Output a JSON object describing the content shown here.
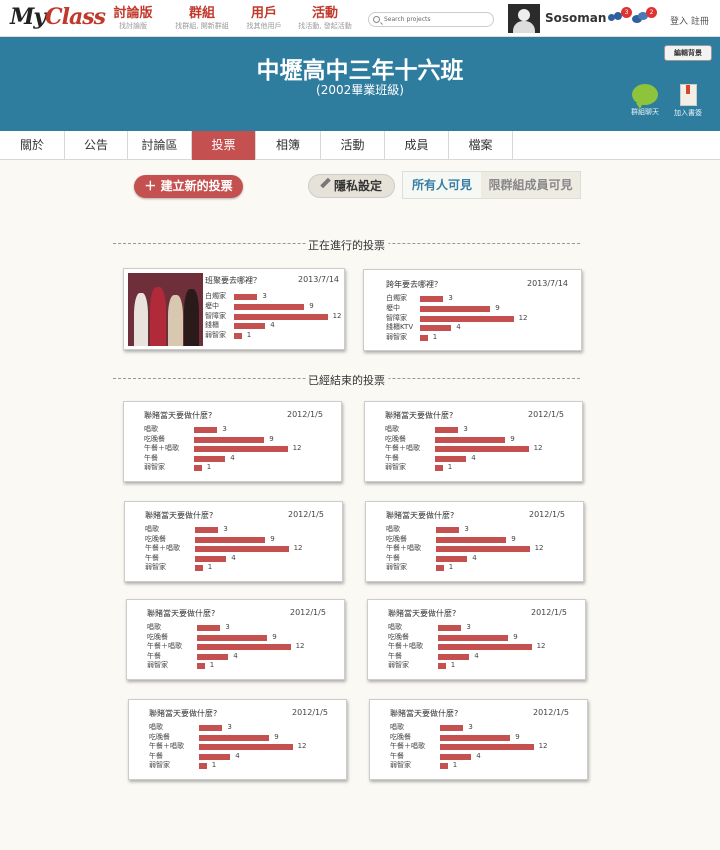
{
  "nav": {
    "logo_main": "My",
    "logo_accent": "Class",
    "items": [
      {
        "label": "討論版",
        "sub": "找討論版"
      },
      {
        "label": "群組",
        "sub": "找群組, 開新群組"
      },
      {
        "label": "用戶",
        "sub": "找其他用戶"
      },
      {
        "label": "活動",
        "sub": "找活動, 發起活動"
      }
    ],
    "search_placeholder": "Search projects",
    "username": "Sosoman",
    "badge_friends": "3",
    "badge_messages": "2",
    "login_label": "登入 註冊"
  },
  "banner": {
    "title": "中壢高中三年十六班",
    "subtitle": "(2002畢業班級)",
    "edit_bg_label": "編輯背景",
    "chat_label": "群組聊天",
    "bookmark_label": "加入書簽",
    "bg_color": "#2e7c9e"
  },
  "tabs": [
    "關於",
    "公告",
    "討論區",
    "投票",
    "相簿",
    "活動",
    "成員",
    "檔案"
  ],
  "active_tab": "投票",
  "toolbar": {
    "new_poll": "建立新的投票",
    "privacy": "隱私設定",
    "visibility_all": "所有人可見",
    "visibility_members": "限群組成員可見"
  },
  "sections": {
    "ongoing": "正在進行的投票",
    "ended": "已經結束的投票"
  },
  "ongoing_polls": [
    {
      "title": "班聚要去哪裡？",
      "date": "2013/7/14",
      "has_photo": true,
      "options": [
        {
          "label": "白燭家",
          "count": 3
        },
        {
          "label": "壢中",
          "count": 9
        },
        {
          "label": "智障家",
          "count": 12
        },
        {
          "label": "錢櫃",
          "count": 4
        },
        {
          "label": "弱智家",
          "count": 1
        }
      ]
    },
    {
      "title": "跨年要去哪裡？",
      "date": "2013/7/14",
      "has_photo": false,
      "options": [
        {
          "label": "白燭家",
          "count": 3
        },
        {
          "label": "壢中",
          "count": 9
        },
        {
          "label": "智障家",
          "count": 12
        },
        {
          "label": "錢櫃KTV",
          "count": 4
        },
        {
          "label": "弱智家",
          "count": 1
        }
      ]
    }
  ],
  "ended_polls": [
    {
      "title": "聯賭當天要做什麼?",
      "date": "2012/1/5",
      "options": [
        {
          "label": "唱歌",
          "count": 3
        },
        {
          "label": "吃晚餐",
          "count": 9
        },
        {
          "label": "午餐＋唱歌",
          "count": 12
        },
        {
          "label": "午餐",
          "count": 4
        },
        {
          "label": "弱智家",
          "count": 1
        }
      ]
    },
    {
      "title": "聯賭當天要做什麼?",
      "date": "2012/1/5",
      "options": [
        {
          "label": "唱歌",
          "count": 3
        },
        {
          "label": "吃晚餐",
          "count": 9
        },
        {
          "label": "午餐＋唱歌",
          "count": 12
        },
        {
          "label": "午餐",
          "count": 4
        },
        {
          "label": "弱智家",
          "count": 1
        }
      ]
    },
    {
      "title": "聯賭當天要做什麼?",
      "date": "2012/1/5",
      "options": [
        {
          "label": "唱歌",
          "count": 3
        },
        {
          "label": "吃晚餐",
          "count": 9
        },
        {
          "label": "午餐＋唱歌",
          "count": 12
        },
        {
          "label": "午餐",
          "count": 4
        },
        {
          "label": "弱智家",
          "count": 1
        }
      ]
    },
    {
      "title": "聯賭當天要做什麼?",
      "date": "2012/1/5",
      "options": [
        {
          "label": "唱歌",
          "count": 3
        },
        {
          "label": "吃晚餐",
          "count": 9
        },
        {
          "label": "午餐＋唱歌",
          "count": 12
        },
        {
          "label": "午餐",
          "count": 4
        },
        {
          "label": "弱智家",
          "count": 1
        }
      ]
    },
    {
      "title": "聯賭當天要做什麼?",
      "date": "2012/1/5",
      "options": [
        {
          "label": "唱歌",
          "count": 3
        },
        {
          "label": "吃晚餐",
          "count": 9
        },
        {
          "label": "午餐＋唱歌",
          "count": 12
        },
        {
          "label": "午餐",
          "count": 4
        },
        {
          "label": "弱智家",
          "count": 1
        }
      ]
    },
    {
      "title": "聯賭當天要做什麼?",
      "date": "2012/1/5",
      "options": [
        {
          "label": "唱歌",
          "count": 3
        },
        {
          "label": "吃晚餐",
          "count": 9
        },
        {
          "label": "午餐＋唱歌",
          "count": 12
        },
        {
          "label": "午餐",
          "count": 4
        },
        {
          "label": "弱智家",
          "count": 1
        }
      ]
    },
    {
      "title": "聯賭當天要做什麼?",
      "date": "2012/1/5",
      "options": [
        {
          "label": "唱歌",
          "count": 3
        },
        {
          "label": "吃晚餐",
          "count": 9
        },
        {
          "label": "午餐＋唱歌",
          "count": 12
        },
        {
          "label": "午餐",
          "count": 4
        },
        {
          "label": "弱智家",
          "count": 1
        }
      ]
    },
    {
      "title": "聯賭當天要做什麼?",
      "date": "2012/1/5",
      "options": [
        {
          "label": "唱歌",
          "count": 3
        },
        {
          "label": "吃晚餐",
          "count": 9
        },
        {
          "label": "午餐＋唱歌",
          "count": 12
        },
        {
          "label": "午餐",
          "count": 4
        },
        {
          "label": "弱智家",
          "count": 1
        }
      ]
    }
  ],
  "colors": {
    "accent": "#c4504f",
    "bar": "#c4504f",
    "link_blue": "#3a7ea5",
    "chat_green": "#8ec33c"
  }
}
